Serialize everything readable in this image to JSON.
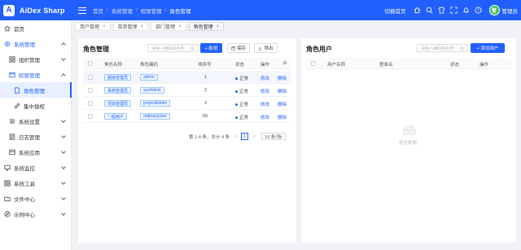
{
  "app": {
    "logo_letter": "A",
    "name": "AiDex Sharp"
  },
  "breadcrumb": [
    "首页",
    "系统管理",
    "权限管理",
    "角色管理"
  ],
  "header": {
    "switch_home": "切换首页",
    "username": "管理员",
    "avatar_text": "管"
  },
  "sidebar": {
    "items": [
      {
        "label": "首页"
      },
      {
        "label": "系统管理"
      },
      {
        "label": "组织管理"
      },
      {
        "label": "权限管理"
      },
      {
        "label": "角色管理"
      },
      {
        "label": "集中授权"
      },
      {
        "label": "系统设置"
      },
      {
        "label": "日志管理"
      },
      {
        "label": "系统应用"
      },
      {
        "label": "系统监控"
      },
      {
        "label": "系统工具"
      },
      {
        "label": "文件中心"
      },
      {
        "label": "示例中心"
      }
    ]
  },
  "tabs": [
    {
      "label": "用户管理",
      "close": "×"
    },
    {
      "label": "菜单管理",
      "close": "×"
    },
    {
      "label": "部门管理",
      "close": "×"
    },
    {
      "label": "角色管理",
      "close": "×"
    }
  ],
  "role_panel": {
    "title": "角色管理",
    "search_placeholder": "请输入编码或名称",
    "add_label": "+ 新增",
    "save_label": "保存",
    "export_label": "导出",
    "columns": [
      "角色名称",
      "角色编码",
      "排序号",
      "状态",
      "操作"
    ],
    "rows": [
      {
        "name": "超级管理员",
        "code": "admin",
        "sort": "1",
        "status": "正常",
        "edit": "修改",
        "delete": "删除"
      },
      {
        "name": "系统管理员",
        "code": "sysAdmin",
        "sort": "2",
        "status": "正常",
        "edit": "修改",
        "delete": "删除"
      },
      {
        "name": "项目管理员",
        "code": "projectAdmin",
        "sort": "3",
        "status": "正常",
        "edit": "修改",
        "delete": "删除"
      },
      {
        "name": "一般用户",
        "code": "ordinaryUser",
        "sort": "50",
        "status": "正常",
        "edit": "修改",
        "delete": "删除"
      }
    ],
    "pagination": {
      "summary": "第 1-4 条，总计 4 条",
      "prev": "<",
      "page": "1",
      "next": ">",
      "page_size": "10 条/页"
    }
  },
  "user_panel": {
    "title": "角色用户",
    "search_placeholder": "请输入编码或名称",
    "add_label": "+ 添加用户",
    "columns": [
      "用户名称",
      "登录名",
      "状态",
      "操作"
    ],
    "empty_text": "暂无数据"
  },
  "colors": {
    "primary": "#2160ff",
    "tag_border": "#9cc7ff",
    "tag_bg": "#eef6ff",
    "avatar": "#3ec34b"
  }
}
